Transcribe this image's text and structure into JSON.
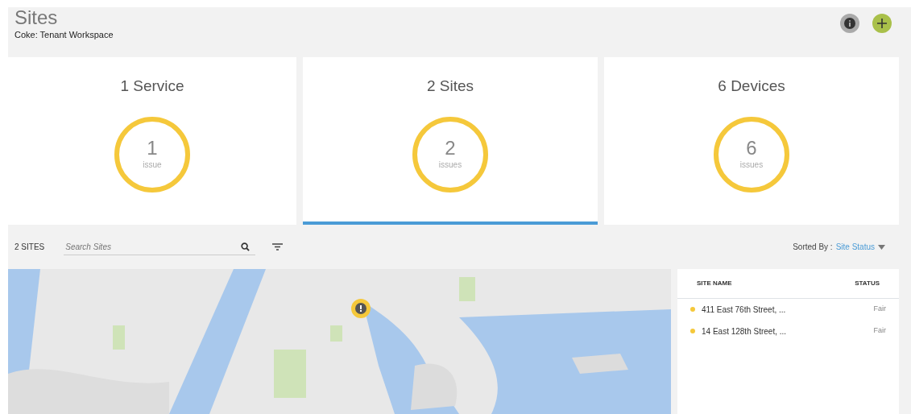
{
  "header": {
    "title": "Sites",
    "subtitle": "Coke: Tenant Workspace"
  },
  "summary_cards": [
    {
      "title": "1 Service",
      "count": "1",
      "unit": "issue",
      "selected": false
    },
    {
      "title": "2 Sites",
      "count": "2",
      "unit": "issues",
      "selected": true
    },
    {
      "title": "6 Devices",
      "count": "6",
      "unit": "issues",
      "selected": false
    }
  ],
  "toolbar": {
    "site_count": "2 SITES",
    "search": {
      "placeholder": "Search Sites"
    },
    "sorted_by_label": "Sorted By :",
    "sorted_by_value": "Site Status"
  },
  "site_table": {
    "columns": [
      "SITE NAME",
      "STATUS"
    ],
    "rows": [
      {
        "name": "411 East 76th Street, ...",
        "status": "Fair",
        "color": "#f5c83b"
      },
      {
        "name": "14 East 128th Street, ...",
        "status": "Fair",
        "color": "#f5c83b"
      }
    ]
  }
}
